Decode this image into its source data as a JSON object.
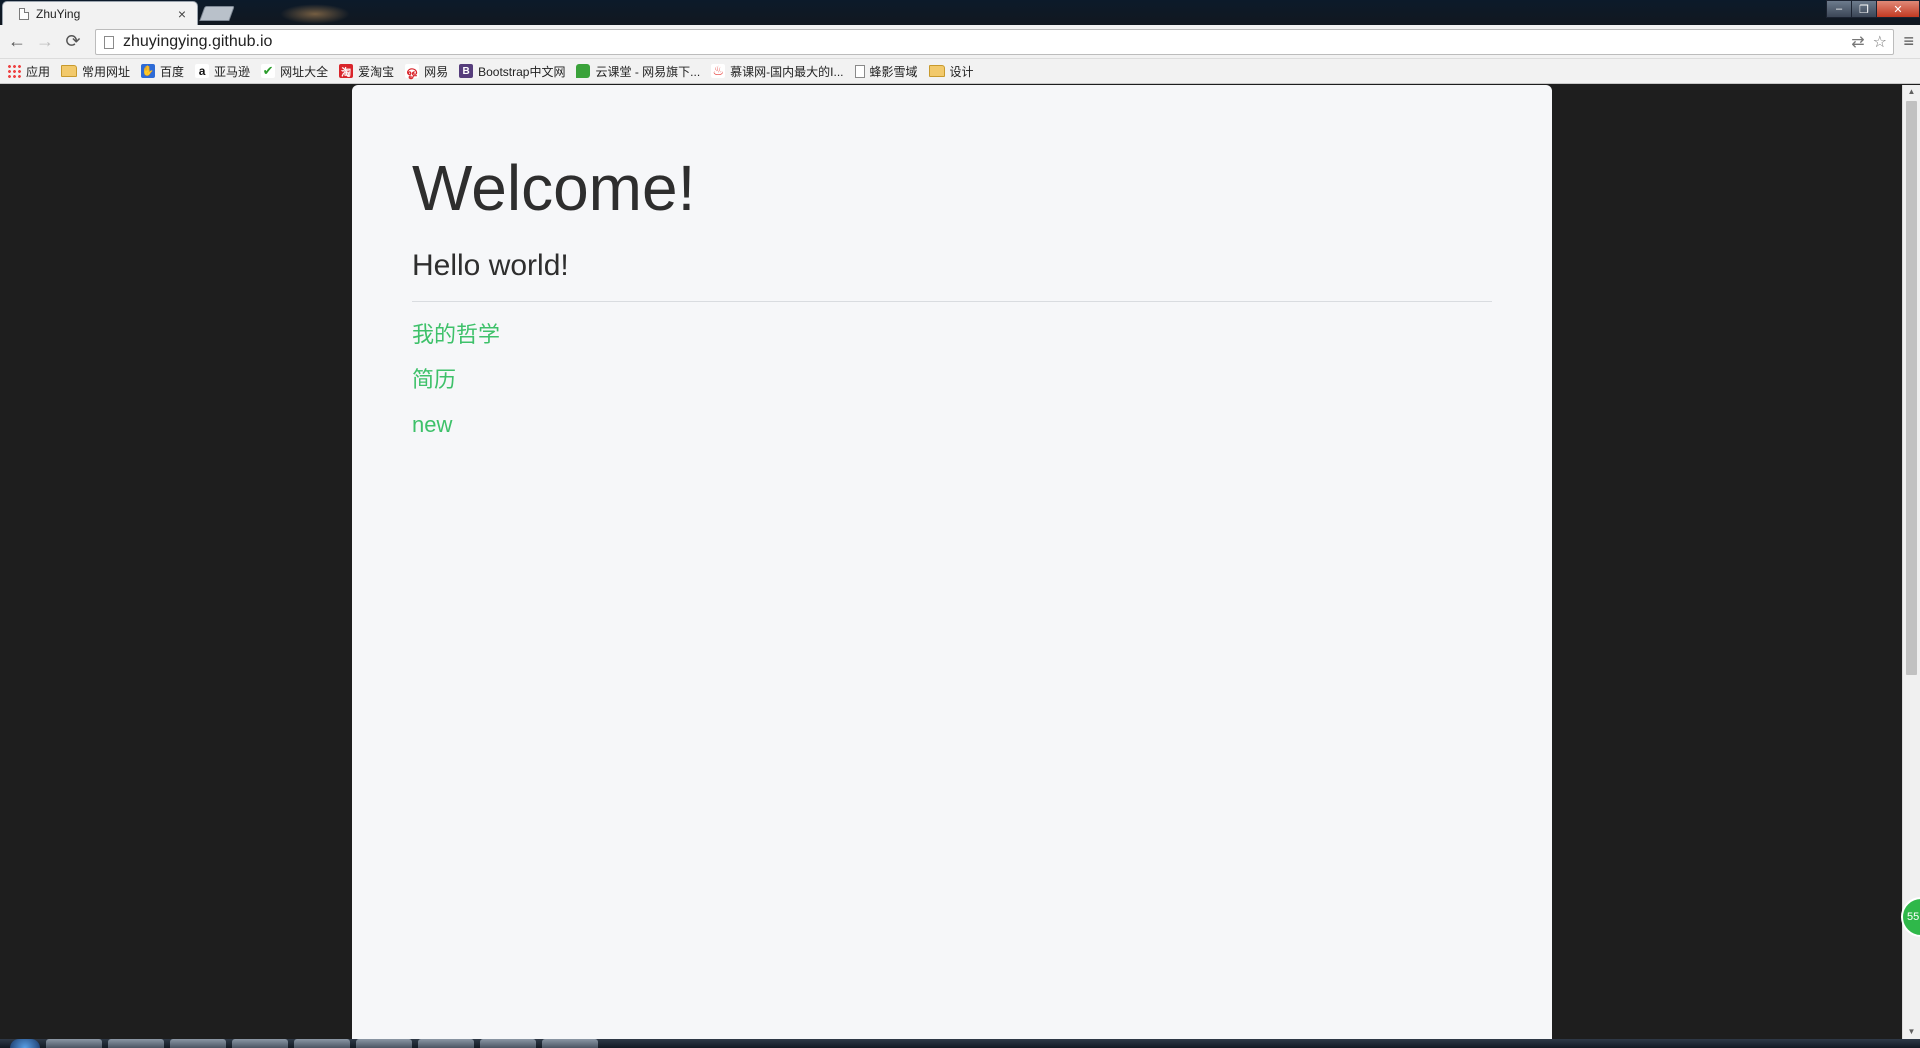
{
  "browser": {
    "tab": {
      "title": "ZhuYing",
      "close": "×"
    },
    "window_controls": {
      "minimize": "–",
      "restore": "❐",
      "close": "✕"
    },
    "toolbar": {
      "back": "←",
      "forward": "→",
      "reload": "⟳",
      "url": "zhuyingying.github.io",
      "translate_icon": "⇄",
      "star_icon": "☆",
      "menu_icon": "≡"
    },
    "bookmarks": [
      {
        "label": "应用",
        "icon": "apps-icon"
      },
      {
        "label": "常用网址",
        "icon": "folder-icon"
      },
      {
        "label": "百度",
        "icon": "baidu-icon",
        "glyph": ""
      },
      {
        "label": "亚马逊",
        "icon": "amazon-icon",
        "glyph": "a"
      },
      {
        "label": "网址大全",
        "icon": "check-icon",
        "glyph": "✔"
      },
      {
        "label": "爱淘宝",
        "icon": "aitaobao-icon",
        "glyph": "淘"
      },
      {
        "label": "网易",
        "icon": "netease-icon",
        "glyph": "ஓ"
      },
      {
        "label": "Bootstrap中文网",
        "icon": "bootstrap-icon",
        "glyph": "B"
      },
      {
        "label": "云课堂 - 网易旗下...",
        "icon": "yunketang-icon",
        "glyph": ""
      },
      {
        "label": "慕课网-国内最大的I...",
        "icon": "fire-icon",
        "glyph": "♨"
      },
      {
        "label": "蜂影雪域",
        "icon": "page-icon",
        "glyph": ""
      },
      {
        "label": "设计",
        "icon": "folder-icon"
      }
    ]
  },
  "page": {
    "heading": "Welcome!",
    "subheading": "Hello world!",
    "links": [
      {
        "label": "我的哲学"
      },
      {
        "label": "简历"
      },
      {
        "label": "new"
      }
    ],
    "link_color": "#3ec16a",
    "background": "#1e1e1e",
    "card_background": "#f6f7f9"
  },
  "scrollbar": {
    "up": "▲",
    "down": "▼"
  },
  "floating_badge": {
    "text": "55"
  }
}
